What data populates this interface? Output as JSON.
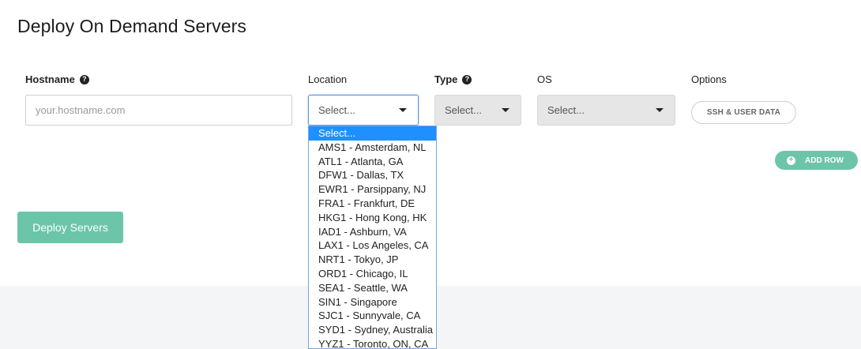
{
  "page": {
    "title": "Deploy On Demand Servers"
  },
  "form": {
    "hostname": {
      "label": "Hostname",
      "help_icon": "?",
      "placeholder": "your.hostname.com",
      "value": ""
    },
    "location": {
      "label": "Location",
      "selected": "Select..."
    },
    "type": {
      "label": "Type",
      "help_icon": "?",
      "selected": "Select..."
    },
    "os": {
      "label": "OS",
      "selected": "Select..."
    },
    "options": {
      "label": "Options",
      "button_label": "SSH & USER DATA"
    }
  },
  "add_row": {
    "icon": "+",
    "label": "ADD ROW"
  },
  "deploy": {
    "label": "Deploy Servers"
  },
  "location_dropdown": {
    "items": [
      "Select...",
      "AMS1 - Amsterdam, NL",
      "ATL1 - Atlanta, GA",
      "DFW1 - Dallas, TX",
      "EWR1 - Parsippany, NJ",
      "FRA1 - Frankfurt, DE",
      "HKG1 - Hong Kong, HK",
      "IAD1 - Ashburn, VA",
      "LAX1 - Los Angeles, CA",
      "NRT1 - Tokyo, JP",
      "ORD1 - Chicago, IL",
      "SEA1 - Seattle, WA",
      "SIN1 - Singapore",
      "SJC1 - Sunnyvale, CA",
      "SYD1 - Sydney, Australia",
      "YYZ1 - Toronto, ON, CA"
    ],
    "highlighted": "Select..."
  },
  "colors": {
    "accent": "#6cc5a9",
    "highlight": "#1e90ff",
    "footer": "#f4f5f7"
  }
}
